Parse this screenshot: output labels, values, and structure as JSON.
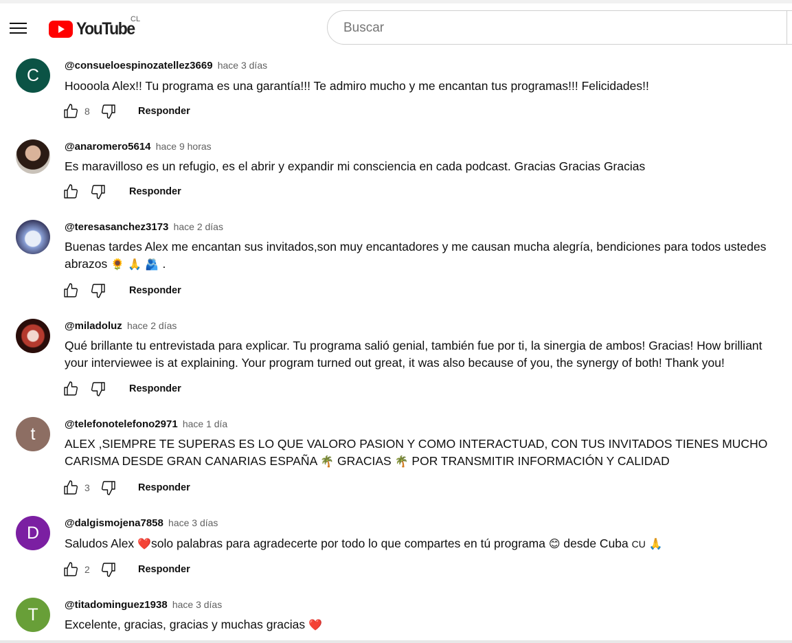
{
  "masthead": {
    "logo_text": "YouTube",
    "country_code": "CL",
    "search_placeholder": "Buscar"
  },
  "colors": {
    "brand_red": "#ff0000"
  },
  "reply_label": "Responder",
  "comments": [
    {
      "author": "@consueloespinozatellez3669",
      "time": "hace 3 días",
      "avatar_letter": "C",
      "avatar_color": "#0b5345",
      "text": "Hoooola Alex!! Tu programa es una garantía!!! Te admiro mucho y me encantan tus programas!!! Felicidades!!",
      "likes": "8"
    },
    {
      "author": "@anaromero5614",
      "time": "hace 9 horas",
      "avatar_letter": "",
      "avatar_color": "#6b4a3a",
      "text": "Es maravilloso es un refugio, es el abrir y expandir mi consciencia en cada podcast. Gracias Gracias Gracias",
      "likes": ""
    },
    {
      "author": "@teresasanchez3173",
      "time": "hace 2 días",
      "avatar_letter": "",
      "avatar_color": "#5a5f86",
      "text": "Buenas tardes Alex me encantan sus invitados,son muy encantadores y me causan mucha alegría, bendiciones para todos ustedes abrazos",
      "text_emoji": " 🌻 🙏 🫂 .",
      "likes": ""
    },
    {
      "author": "@miladoluz",
      "time": "hace 2 días",
      "avatar_letter": "",
      "avatar_color": "#3a1410",
      "text": "Qué brillante tu entrevistada para explicar. Tu programa salió genial, también fue por ti, la sinergia de ambos! Gracias! How brilliant your interviewee is at explaining. Your program turned out great, it was also because of you, the synergy of both! Thank you!",
      "likes": ""
    },
    {
      "author": "@telefonotelefono2971",
      "time": "hace 1 día",
      "avatar_letter": "t",
      "avatar_color": "#8d6e63",
      "text_part1": "ALEX ,SIEMPRE TE SUPERAS ES LO QUE VALORO PASION Y COMO INTERACTUAD, CON TUS INVITADOS TIENES MUCHO CARISMA DESDE GRAN CANARIAS ESPAÑA",
      "emoji1": "🌴",
      "text_part2": "GRACIAS",
      "emoji2": "🌴",
      "text_part3": "POR TRANSMITIR INFORMACIÓN Y CALIDAD",
      "likes": "3"
    },
    {
      "author": "@dalgismojena7858",
      "time": "hace 3 días",
      "avatar_letter": "D",
      "avatar_color": "#7b1fa2",
      "text_part1": "Saludos Alex",
      "emoji1": "❤️",
      "text_part2": "solo palabras para agradecerte por todo lo que compartes en tú programa",
      "emoji2": "😊",
      "text_part3": "desde Cuba",
      "flag": "CU",
      "emoji3": "🙏",
      "likes": "2"
    },
    {
      "author": "@titadominguez1938",
      "time": "hace 3 días",
      "avatar_letter": "T",
      "avatar_color": "#689f38",
      "text": "Excelente, gracias, gracias y muchas gracias",
      "emoji1": "❤️",
      "likes": ""
    }
  ]
}
